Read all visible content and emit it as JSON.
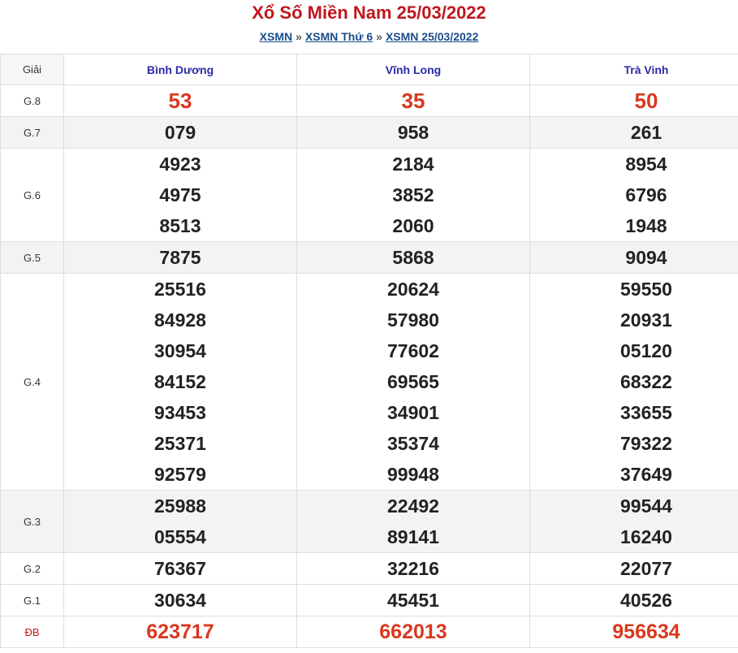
{
  "header": {
    "title": "Xổ Số Miền Nam 25/03/2022",
    "breadcrumb": [
      "XSMN",
      "XSMN Thứ 6",
      "XSMN 25/03/2022"
    ],
    "separator": "»"
  },
  "table": {
    "giai_label": "Giải",
    "provinces": [
      "Bình Dương",
      "Vĩnh Long",
      "Trà Vinh"
    ],
    "rows": [
      {
        "label": "G.8",
        "values": [
          [
            "53"
          ],
          [
            "35"
          ],
          [
            "50"
          ]
        ]
      },
      {
        "label": "G.7",
        "values": [
          [
            "079"
          ],
          [
            "958"
          ],
          [
            "261"
          ]
        ]
      },
      {
        "label": "G.6",
        "values": [
          [
            "4923",
            "4975",
            "8513"
          ],
          [
            "2184",
            "3852",
            "2060"
          ],
          [
            "8954",
            "6796",
            "1948"
          ]
        ]
      },
      {
        "label": "G.5",
        "values": [
          [
            "7875"
          ],
          [
            "5868"
          ],
          [
            "9094"
          ]
        ]
      },
      {
        "label": "G.4",
        "values": [
          [
            "25516",
            "84928",
            "30954",
            "84152",
            "93453",
            "25371",
            "92579"
          ],
          [
            "20624",
            "57980",
            "77602",
            "69565",
            "34901",
            "35374",
            "99948"
          ],
          [
            "59550",
            "20931",
            "05120",
            "68322",
            "33655",
            "79322",
            "37649"
          ]
        ]
      },
      {
        "label": "G.3",
        "values": [
          [
            "25988",
            "05554"
          ],
          [
            "22492",
            "89141"
          ],
          [
            "99544",
            "16240"
          ]
        ]
      },
      {
        "label": "G.2",
        "values": [
          [
            "76367"
          ],
          [
            "32216"
          ],
          [
            "22077"
          ]
        ]
      },
      {
        "label": "G.1",
        "values": [
          [
            "30634"
          ],
          [
            "45451"
          ],
          [
            "40526"
          ]
        ]
      },
      {
        "label": "ĐB",
        "values": [
          [
            "623717"
          ],
          [
            "662013"
          ],
          [
            "956634"
          ]
        ]
      }
    ]
  },
  "colors": {
    "title": "#c0171d",
    "link": "#1a4c8a",
    "province": "#2a2aa8",
    "highlight_number": "#d9381e",
    "row_shade": "#f3f3f3"
  }
}
